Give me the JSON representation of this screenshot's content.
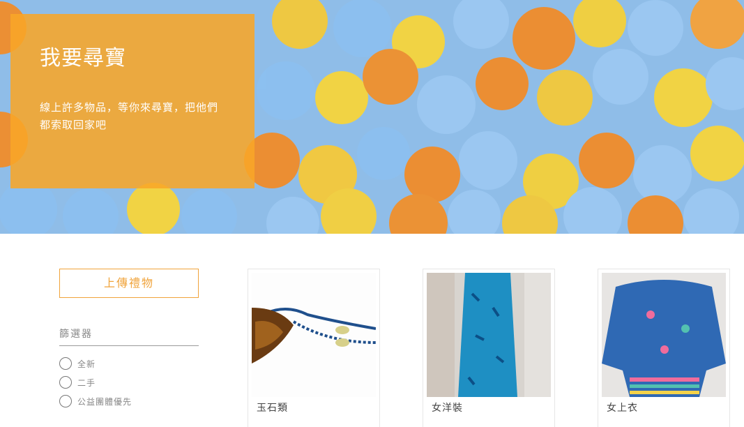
{
  "hero": {
    "title": "我要尋寶",
    "description": "線上許多物品，等你來尋寶，把他們都索取回家吧"
  },
  "sidebar": {
    "upload_label": "上傳禮物",
    "filter_title": "篩選器",
    "options": [
      {
        "label": "全新"
      },
      {
        "label": "二手"
      },
      {
        "label": "公益團體優先"
      }
    ]
  },
  "products": [
    {
      "label": "玉石類"
    },
    {
      "label": "女洋裝"
    },
    {
      "label": "女上衣"
    }
  ],
  "colors": {
    "accent": "#f0a33a",
    "hero_overlay": "#f8a628"
  }
}
